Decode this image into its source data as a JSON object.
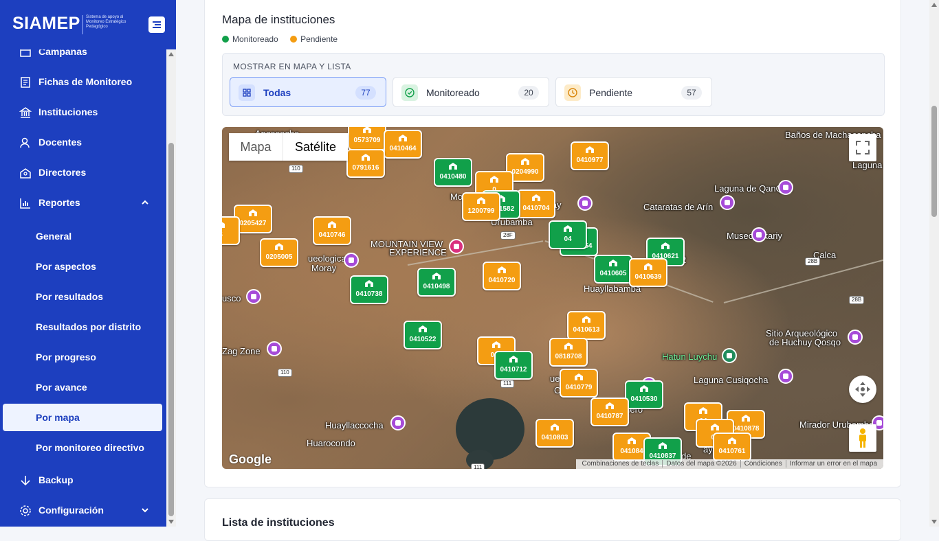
{
  "brand": {
    "name": "SIAMEP",
    "subtitle": "Sistema de apoyo al Monitoreo Estratégico Pedagógico"
  },
  "sidebar": {
    "items": [
      {
        "label": "Campañas"
      },
      {
        "label": "Fichas de Monitoreo"
      },
      {
        "label": "Instituciones"
      },
      {
        "label": "Docentes"
      },
      {
        "label": "Directores"
      },
      {
        "label": "Reportes"
      },
      {
        "label": "Backup"
      },
      {
        "label": "Configuración"
      }
    ],
    "reportes_sub": [
      {
        "label": "General"
      },
      {
        "label": "Por aspectos"
      },
      {
        "label": "Por resultados"
      },
      {
        "label": "Resultados por distrito"
      },
      {
        "label": "Por progreso"
      },
      {
        "label": "Por avance"
      },
      {
        "label": "Por mapa"
      },
      {
        "label": "Por monitoreo directivo"
      }
    ],
    "active_sub": "Por mapa"
  },
  "map_section": {
    "title": "Mapa de instituciones",
    "legend": [
      {
        "label": "Monitoreado",
        "color": "#11a04a"
      },
      {
        "label": "Pendiente",
        "color": "#f49d12"
      }
    ],
    "filter_label": "MOSTRAR EN MAPA Y LISTA",
    "filters": [
      {
        "label": "Todas",
        "count": "77"
      },
      {
        "label": "Monitoreado",
        "count": "20"
      },
      {
        "label": "Pendiente",
        "count": "57"
      }
    ]
  },
  "map": {
    "type_map": "Mapa",
    "type_satellite": "Satélite",
    "attribution": [
      "Combinaciones de teclas",
      "Datos del mapa ©2026",
      "Condiciones",
      "Informar un error en el mapa"
    ],
    "logo": "Google",
    "places": [
      "Ancasocha",
      "Baños de Machacancha",
      "Laguna",
      "Laguna de QanQan",
      "Cataratas de Arín",
      "Museo Inkariy",
      "Calca",
      "Mo",
      "Urubamba",
      "ucay",
      "MOUNTAIN VIEW",
      "EXPERIENCE",
      "ueologica",
      "Moray",
      "usco",
      "Zag Zone",
      "Huayllabamba",
      "Sitio Arqueológico",
      "de Huchuy Qosqo",
      "Hatun Luychu",
      "Laguna Cusiqocha",
      "Huayllaccocha",
      "Huarocondo",
      "Mirador Urubamba",
      "Laguna de",
      "ueológico",
      "Chinch",
      "hinero",
      "ay",
      "2"
    ],
    "roads": [
      "110",
      "28F",
      "28B",
      "28B",
      "110",
      "111",
      "111"
    ],
    "markers": [
      {
        "code": "0573709",
        "status": "orange"
      },
      {
        "code": "0410464",
        "status": "orange"
      },
      {
        "code": "0791616",
        "status": "orange"
      },
      {
        "code": "0410480",
        "status": "green"
      },
      {
        "code": "0204990",
        "status": "orange"
      },
      {
        "code": "0410977",
        "status": "orange"
      },
      {
        "code": "0",
        "status": "orange"
      },
      {
        "code": "0410704",
        "status": "orange"
      },
      {
        "code": "0411582",
        "status": "green"
      },
      {
        "code": "1200799",
        "status": "orange"
      },
      {
        "code": "0205427",
        "status": "orange"
      },
      {
        "code": "5",
        "status": "orange"
      },
      {
        "code": "0410746",
        "status": "orange"
      },
      {
        "code": "0410654",
        "status": "green"
      },
      {
        "code": "04",
        "status": "green"
      },
      {
        "code": "0410621",
        "status": "green"
      },
      {
        "code": "0205005",
        "status": "orange"
      },
      {
        "code": "0410605",
        "status": "green"
      },
      {
        "code": "0410639",
        "status": "orange"
      },
      {
        "code": "0410498",
        "status": "green"
      },
      {
        "code": "0410720",
        "status": "orange"
      },
      {
        "code": "0410738",
        "status": "green"
      },
      {
        "code": "0410613",
        "status": "orange"
      },
      {
        "code": "0410522",
        "status": "green"
      },
      {
        "code": "041",
        "status": "orange"
      },
      {
        "code": "0818708",
        "status": "orange"
      },
      {
        "code": "0410712",
        "status": "green"
      },
      {
        "code": "0410779",
        "status": "orange"
      },
      {
        "code": "0410530",
        "status": "green"
      },
      {
        "code": "0410787",
        "status": "orange"
      },
      {
        "code": "04",
        "status": "orange"
      },
      {
        "code": "0410878",
        "status": "orange"
      },
      {
        "code": "02",
        "status": "orange"
      },
      {
        "code": "0410803",
        "status": "orange"
      },
      {
        "code": "041084",
        "status": "orange"
      },
      {
        "code": "0410837",
        "status": "green"
      },
      {
        "code": "0410761",
        "status": "orange"
      }
    ]
  },
  "list_section": {
    "title": "Lista de instituciones"
  }
}
